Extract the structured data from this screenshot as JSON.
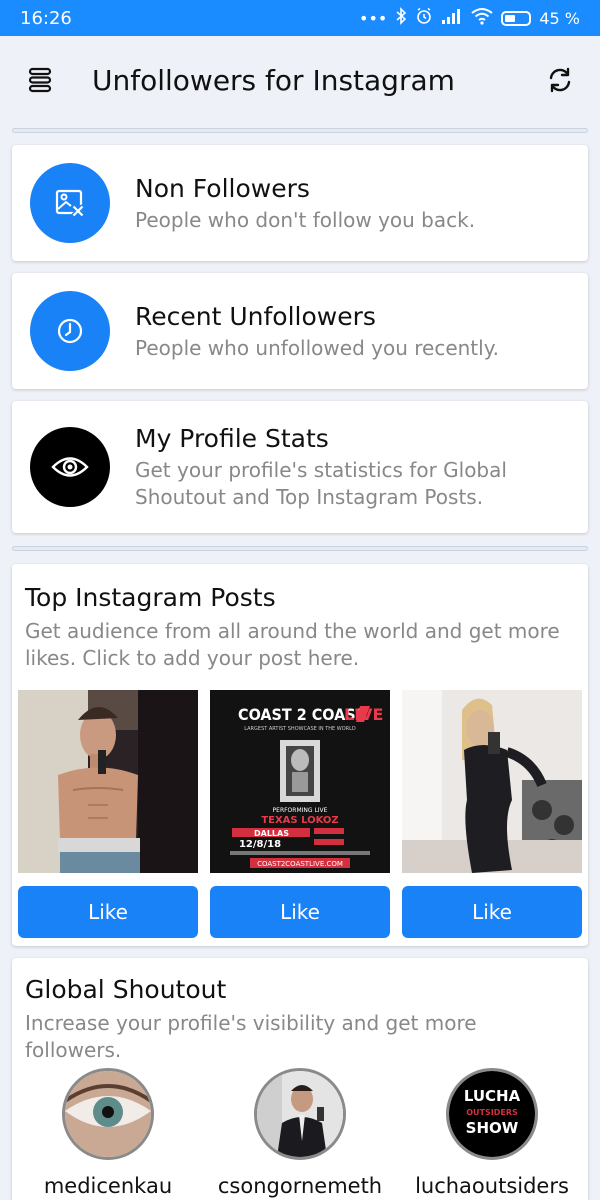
{
  "status_bar": {
    "time": "16:26",
    "battery": "45 %"
  },
  "app_bar": {
    "title": "Unfollowers for Instagram"
  },
  "features": [
    {
      "title": "Non Followers",
      "desc": "People who don't follow you back.",
      "icon": "image-x-icon",
      "color": "#1a82f7"
    },
    {
      "title": "Recent Unfollowers",
      "desc": "People who unfollowed you recently.",
      "icon": "clock-icon",
      "color": "#1a82f7"
    },
    {
      "title": "My Profile Stats",
      "desc": "Get your profile's statistics for Global Shoutout and Top Instagram Posts.",
      "icon": "eye-icon",
      "color": "#000000"
    }
  ],
  "top_posts": {
    "title": "Top Instagram Posts",
    "desc": "Get audience from all around the world and get more likes. Click to add your post here.",
    "poster": {
      "brand": "COAST 2 COAST",
      "brand_live": "LIVE",
      "tagline": "LARGEST ARTIST SHOWCASE IN THE WORLD",
      "performing": "PERFORMING LIVE",
      "artist": "TEXAS LOKOZ",
      "city": "DALLAS",
      "date": "12/8/18",
      "url": "COAST2COASTLIVE.COM"
    },
    "posts": [
      {
        "like_label": "Like"
      },
      {
        "like_label": "Like"
      },
      {
        "like_label": "Like"
      }
    ]
  },
  "shoutout": {
    "title": "Global Shoutout",
    "desc": "Increase your profile's visibility and get more followers.",
    "users": [
      {
        "name": "medicenkau"
      },
      {
        "name": "csongornemeth"
      },
      {
        "name": "luchaoutsiders",
        "logo_text": [
          "LUCHA",
          "OUTSIDERS",
          "SHOW"
        ]
      }
    ]
  },
  "colors": {
    "accent": "#1a82f7",
    "status_bar": "#1a8cff",
    "background": "#eef2f8"
  }
}
